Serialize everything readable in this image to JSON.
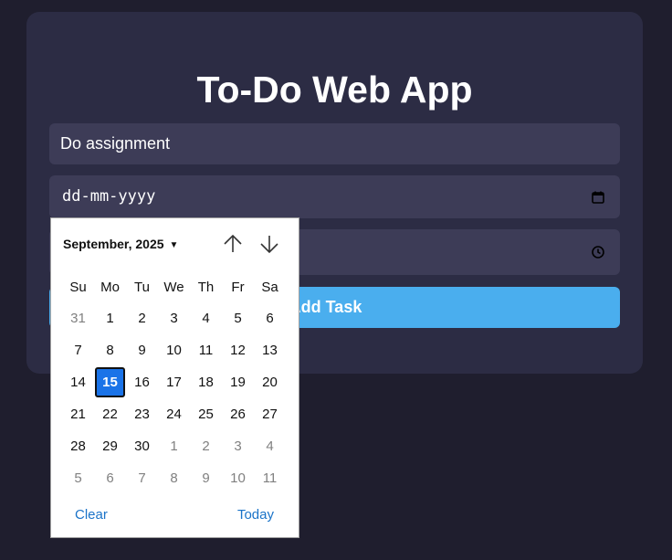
{
  "app": {
    "title": "To-Do Web App"
  },
  "form": {
    "task_value": "Do assignment",
    "date_placeholder": "dd-mm-yyyy",
    "time_value": "",
    "add_button_label": "Add Task"
  },
  "icons": {
    "calendar": "calendar-icon",
    "clock": "clock-icon",
    "caret": "caret-down-icon",
    "up": "arrow-up-icon",
    "down": "arrow-down-icon"
  },
  "colors": {
    "background": "#1f1e2e",
    "card": "#2c2c44",
    "field": "#3d3c57",
    "accent": "#4aaeee",
    "selected_day": "#1a73e8"
  },
  "date_picker": {
    "month_label": "September, 2025",
    "weekdays": [
      "Su",
      "Mo",
      "Tu",
      "We",
      "Th",
      "Fr",
      "Sa"
    ],
    "weeks": [
      [
        {
          "d": "31",
          "other": true
        },
        {
          "d": "1"
        },
        {
          "d": "2"
        },
        {
          "d": "3"
        },
        {
          "d": "4"
        },
        {
          "d": "5"
        },
        {
          "d": "6"
        }
      ],
      [
        {
          "d": "7"
        },
        {
          "d": "8"
        },
        {
          "d": "9"
        },
        {
          "d": "10"
        },
        {
          "d": "11"
        },
        {
          "d": "12"
        },
        {
          "d": "13"
        }
      ],
      [
        {
          "d": "14"
        },
        {
          "d": "15",
          "selected": true
        },
        {
          "d": "16"
        },
        {
          "d": "17"
        },
        {
          "d": "18"
        },
        {
          "d": "19"
        },
        {
          "d": "20"
        }
      ],
      [
        {
          "d": "21"
        },
        {
          "d": "22"
        },
        {
          "d": "23"
        },
        {
          "d": "24"
        },
        {
          "d": "25"
        },
        {
          "d": "26"
        },
        {
          "d": "27"
        }
      ],
      [
        {
          "d": "28"
        },
        {
          "d": "29"
        },
        {
          "d": "30"
        },
        {
          "d": "1",
          "other": true
        },
        {
          "d": "2",
          "other": true
        },
        {
          "d": "3",
          "other": true
        },
        {
          "d": "4",
          "other": true
        }
      ],
      [
        {
          "d": "5",
          "other": true
        },
        {
          "d": "6",
          "other": true
        },
        {
          "d": "7",
          "other": true
        },
        {
          "d": "8",
          "other": true
        },
        {
          "d": "9",
          "other": true
        },
        {
          "d": "10",
          "other": true
        },
        {
          "d": "11",
          "other": true
        }
      ]
    ],
    "clear_label": "Clear",
    "today_label": "Today"
  }
}
